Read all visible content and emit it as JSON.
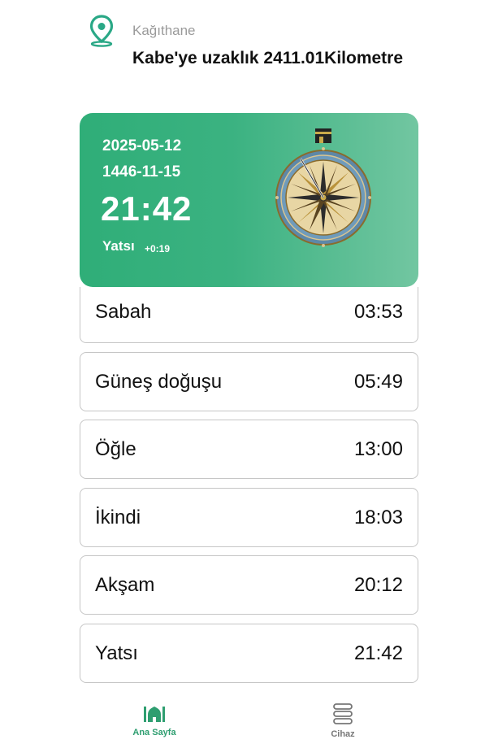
{
  "header": {
    "city": "Kağıthane",
    "distance": "Kabe'ye uzaklık 2411.01Kilometre",
    "location_icon": "location-pin-icon"
  },
  "card": {
    "gregorian_date": "2025-05-12",
    "hijri_date": "1446-11-15",
    "clock": "21:42",
    "current_prayer": "Yatsı",
    "offset": "+0:19",
    "compass_icon": "qibla-compass-icon",
    "accent_color": "#2fae78"
  },
  "prayers": [
    {
      "name": "Sabah",
      "time": "03:53"
    },
    {
      "name": "Güneş doğuşu",
      "time": "05:49"
    },
    {
      "name": "Öğle",
      "time": "13:00"
    },
    {
      "name": "İkindi",
      "time": "18:03"
    },
    {
      "name": "Akşam",
      "time": "20:12"
    },
    {
      "name": "Yatsı",
      "time": "21:42"
    }
  ],
  "tabs": {
    "home": {
      "label": "Ana Sayfa",
      "icon": "mosque-icon",
      "active": true
    },
    "device": {
      "label": "Cihaz",
      "icon": "device-stack-icon",
      "active": false
    }
  }
}
